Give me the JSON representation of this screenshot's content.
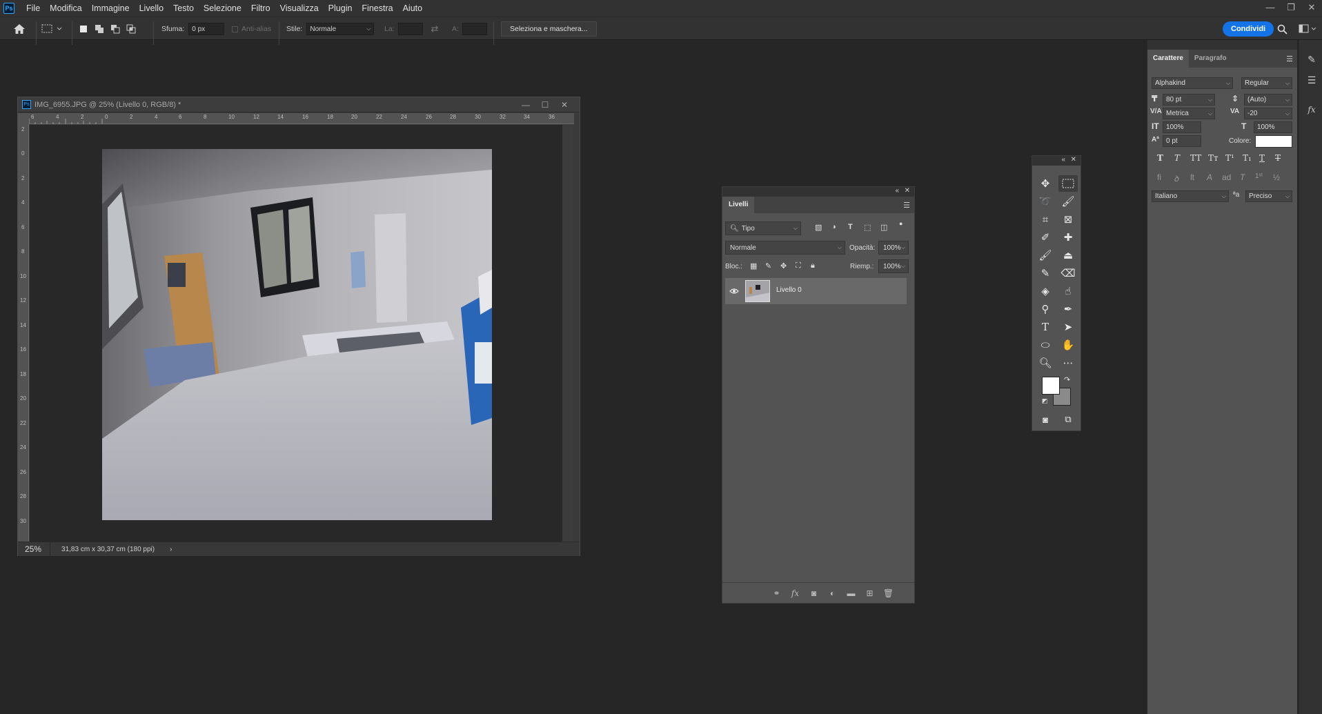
{
  "menubar": {
    "items": [
      "File",
      "Modifica",
      "Immagine",
      "Livello",
      "Testo",
      "Selezione",
      "Filtro",
      "Visualizza",
      "Plugin",
      "Finestra",
      "Aiuto"
    ],
    "controls": [
      "—",
      "❐",
      "✕"
    ]
  },
  "options": {
    "feather_label": "Sfuma:",
    "feather_value": "0 px",
    "antialias_label": "Anti-alias",
    "style_label": "Stile:",
    "style_value": "Normale",
    "width_label": "La:",
    "height_label": "A:",
    "select_mask_button": "Seleziona e maschera...",
    "share_button": "Condividi"
  },
  "document": {
    "title": "IMG_6955.JPG @ 25% (Livello 0, RGB/8) *",
    "ruler_h": [
      "6",
      "4",
      "2",
      "0",
      "2",
      "4",
      "6",
      "8",
      "10",
      "12",
      "14",
      "16",
      "18",
      "20",
      "22",
      "24",
      "26",
      "28",
      "30",
      "32",
      "34",
      "36"
    ],
    "ruler_v": [
      "2",
      "0",
      "2",
      "4",
      "6",
      "8",
      "10",
      "12",
      "14",
      "16",
      "18",
      "20",
      "22",
      "24",
      "26",
      "28",
      "30"
    ],
    "zoom": "25%",
    "doc_size": "31,83 cm x 30,37 cm (180 ppi)",
    "status_arrow": "›"
  },
  "layers": {
    "tab": "Livelli",
    "filter_value": "Tipo",
    "blend_mode": "Normale",
    "opacity_label": "Opacità:",
    "opacity_value": "100%",
    "lock_label": "Bloc.:",
    "fill_label": "Riemp.:",
    "fill_value": "100%",
    "layer_name": "Livello 0"
  },
  "character": {
    "tab_character": "Carattere",
    "tab_paragraph": "Paragrafo",
    "font_family": "Alphakind",
    "font_style": "Regular",
    "font_size": "80 pt",
    "leading": "(Auto)",
    "kerning": "Metrica",
    "tracking": "-20",
    "vertical_scale": "100%",
    "horizontal_scale": "100%",
    "baseline_shift": "0 pt",
    "color_label": "Colore:",
    "text_color": "#ffffff",
    "language": "Italiano",
    "antialias": "Preciso",
    "aa_symbol": "ªa"
  },
  "colors": {
    "accent": "#1473e6",
    "foreground": "#ffffff",
    "background": "#8a8a8a"
  }
}
